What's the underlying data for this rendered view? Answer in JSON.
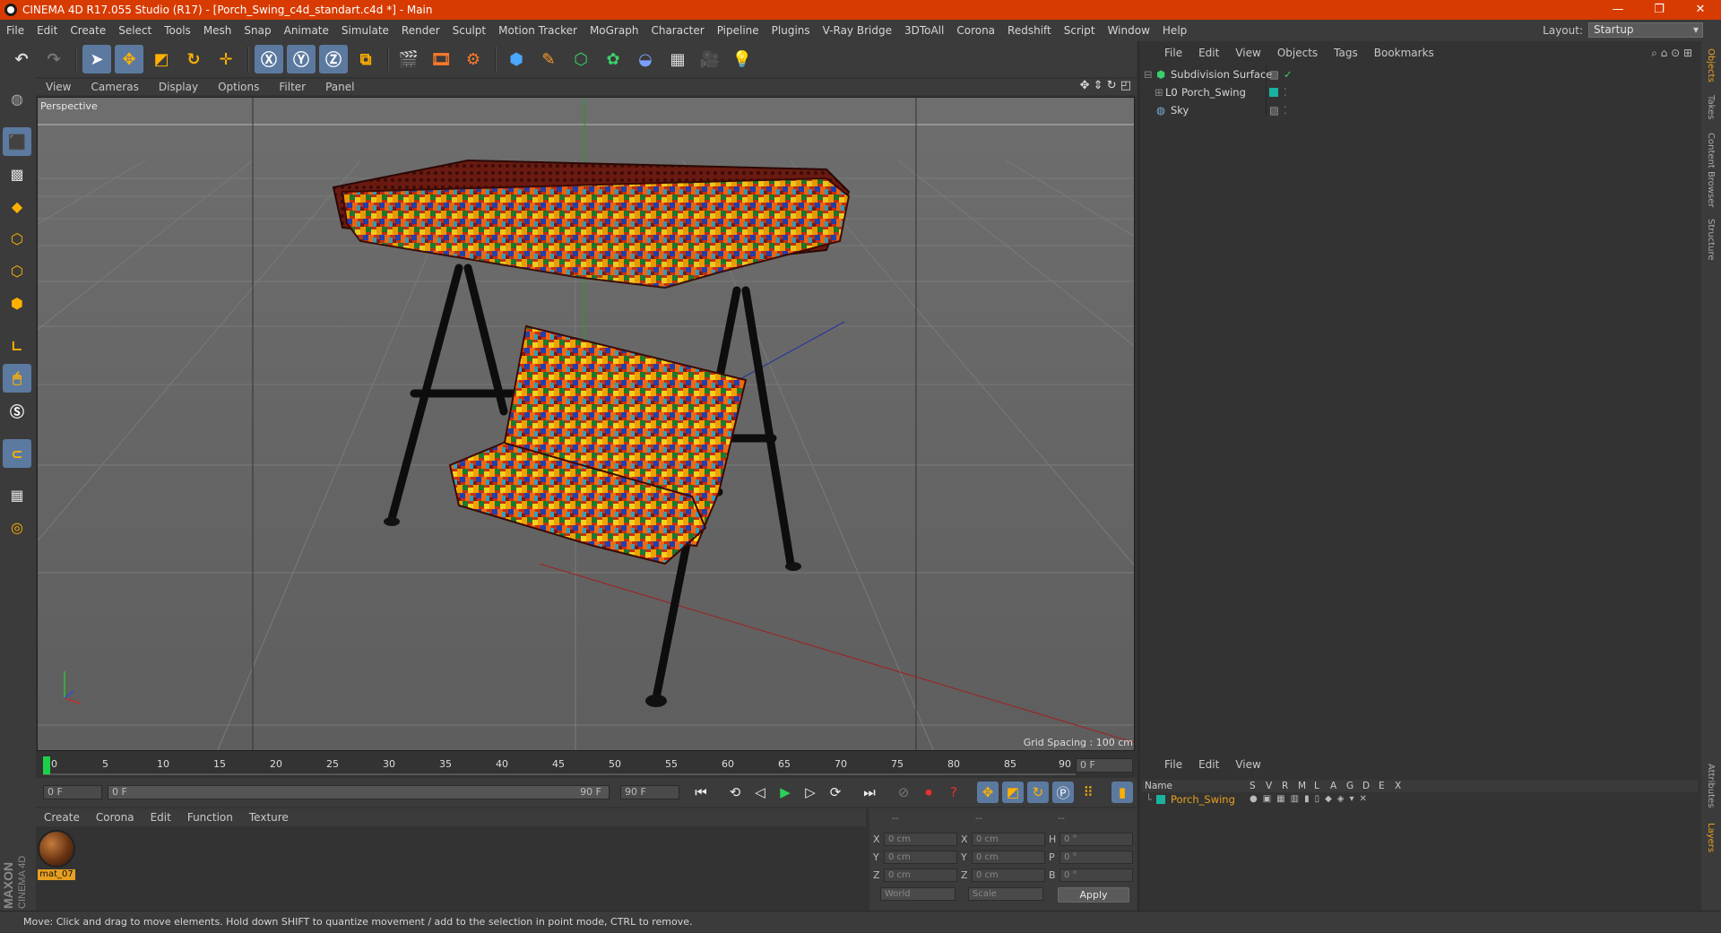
{
  "window": {
    "title": "CINEMA 4D R17.055 Studio (R17) - [Porch_Swing_c4d_standart.c4d *] - Main",
    "controls": [
      "—",
      "❐",
      "✕"
    ]
  },
  "menubar": {
    "items": [
      "File",
      "Edit",
      "Create",
      "Select",
      "Tools",
      "Mesh",
      "Snap",
      "Animate",
      "Simulate",
      "Render",
      "Sculpt",
      "Motion Tracker",
      "MoGraph",
      "Character",
      "Pipeline",
      "Plugins",
      "V-Ray Bridge",
      "3DToAll",
      "Corona",
      "Redshift",
      "Script",
      "Window",
      "Help"
    ],
    "layout_label": "Layout:",
    "layout_value": "Startup"
  },
  "viewport": {
    "menu": [
      "View",
      "Cameras",
      "Display",
      "Options",
      "Filter",
      "Panel"
    ],
    "camera_label": "Perspective",
    "grid_spacing": "Grid Spacing : 100 cm"
  },
  "timeline": {
    "ticks": [
      "0",
      "5",
      "10",
      "15",
      "20",
      "25",
      "30",
      "35",
      "40",
      "45",
      "50",
      "55",
      "60",
      "65",
      "70",
      "75",
      "80",
      "85",
      "90"
    ],
    "end_field": "0 F",
    "start_field": "0 F",
    "range_start": "0 F",
    "range_end": "90 F",
    "max_field": "90 F"
  },
  "materials": {
    "menu": [
      "Create",
      "Corona",
      "Edit",
      "Function",
      "Texture"
    ],
    "items": [
      {
        "name": "mat_07"
      }
    ]
  },
  "coordinates": {
    "header": [
      "--",
      "--",
      "--"
    ],
    "rows": [
      {
        "l1": "X",
        "v1": "0 cm",
        "l2": "X",
        "v2": "0 cm",
        "l3": "H",
        "v3": "0 °"
      },
      {
        "l1": "Y",
        "v1": "0 cm",
        "l2": "Y",
        "v2": "0 cm",
        "l3": "P",
        "v3": "0 °"
      },
      {
        "l1": "Z",
        "v1": "0 cm",
        "l2": "Z",
        "v2": "0 cm",
        "l3": "B",
        "v3": "0 °"
      }
    ],
    "mode": "World",
    "transform": "Scale",
    "apply": "Apply"
  },
  "objects": {
    "menu": [
      "File",
      "Edit",
      "View",
      "Objects",
      "Tags",
      "Bookmarks"
    ],
    "items": [
      {
        "name": "Subdivision Surface"
      },
      {
        "name": "Porch_Swing"
      },
      {
        "name": "Sky"
      }
    ]
  },
  "layers": {
    "menu": [
      "File",
      "Edit",
      "View"
    ],
    "columns": [
      "Name",
      "S",
      "V",
      "R",
      "M",
      "L",
      "A",
      "G",
      "D",
      "E",
      "X"
    ],
    "items": [
      {
        "name": "Porch_Swing"
      }
    ]
  },
  "right_tabs": [
    "Objects",
    "Takes",
    "Content Browser",
    "Structure",
    "Attributes",
    "Layers"
  ],
  "status": "Move: Click and drag to move elements. Hold down SHIFT to quantize movement / add to the selection in point mode, CTRL to remove.",
  "brand": {
    "line1": "MAXON",
    "line2": "CINEMA 4D"
  },
  "colors": {
    "title_bar": "#d83b01",
    "active_tool": "#5c7aa0",
    "layer_color": "#1ab3a0",
    "highlight": "#e8a020"
  }
}
